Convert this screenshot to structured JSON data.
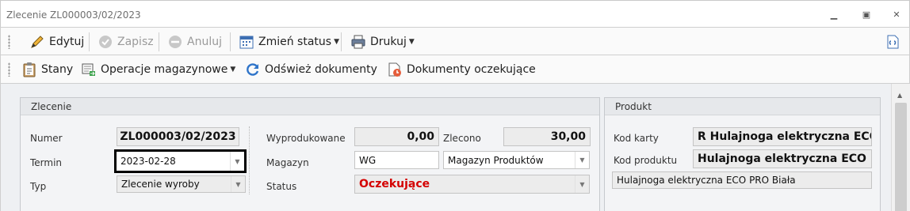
{
  "window": {
    "title": "Zlecenie ZL000003/02/2023"
  },
  "toolbar1": {
    "edit": "Edytuj",
    "save": "Zapisz",
    "cancel": "Anuluj",
    "change_status": "Zmień status",
    "print": "Drukuj"
  },
  "toolbar2": {
    "states": "Stany",
    "warehouse_ops": "Operacje magazynowe",
    "refresh": "Odśwież dokumenty",
    "pending": "Dokumenty oczekujące"
  },
  "order": {
    "header": "Zlecenie",
    "number_label": "Numer",
    "number": "ZL000003/02/2023",
    "term_label": "Termin",
    "term": "2023-02-28",
    "type_label": "Typ",
    "type": "Zlecenie wyroby",
    "produced_label": "Wyprodukowane",
    "produced": "0,00",
    "ordered_label": "Zlecono",
    "ordered": "30,00",
    "warehouse_label": "Magazyn",
    "warehouse_code": "WG",
    "warehouse_name": "Magazyn Produktów",
    "status_label": "Status",
    "status": "Oczekujące",
    "status_color": "#d40000"
  },
  "product": {
    "header": "Produkt",
    "card_label": "Kod karty",
    "card_code": "R Hulajnoga elektryczna ECO P",
    "code_label": "Kod produktu",
    "code": "Hulajnoga elektryczna ECO PRO",
    "description": "Hulajnoga elektryczna ECO PRO Biała"
  },
  "icons": {
    "edit": "pencil-icon",
    "save": "save-disabled-icon",
    "cancel": "cancel-disabled-icon",
    "change_status": "calendar-status-icon",
    "print": "printer-icon",
    "states": "clipboard-icon",
    "warehouse_ops": "warehouse-ops-icon",
    "refresh": "refresh-icon",
    "pending": "pending-documents-icon",
    "side": "document-link-icon"
  }
}
